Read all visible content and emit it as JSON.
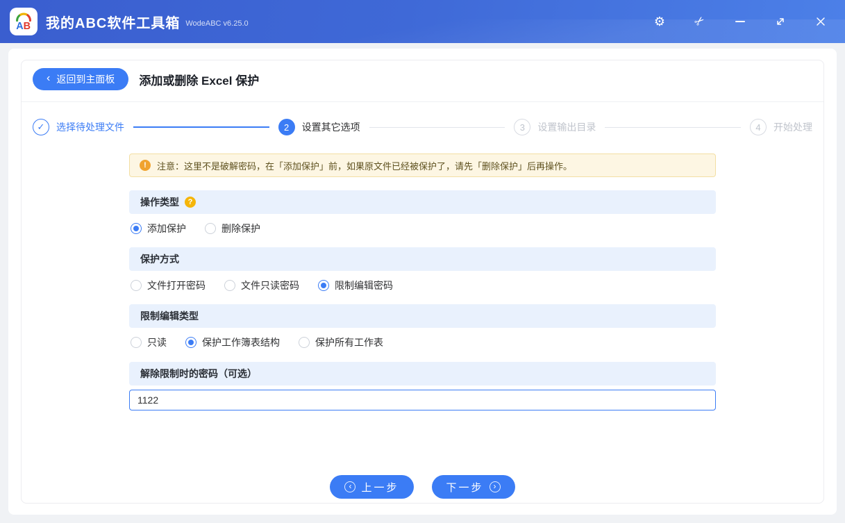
{
  "colors": {
    "accent_blue": "#3b7cf5",
    "titlebar_blue": "#3f66d4",
    "section_header_bg": "#e9f1fd",
    "warning_bg": "#fdf6e3",
    "warning_border": "#f3dfa3",
    "warning_icon": "#f0a32f",
    "help_icon": "#f5b50a",
    "step_inactive_text": "#c0c4cc"
  },
  "icons": {
    "gear": "⚙",
    "scissors": "✂",
    "back_chevron": "‹",
    "check": "✓",
    "help": "?",
    "warning": "!",
    "prev_chevron": "‹",
    "next_chevron": "›"
  },
  "titlebar": {
    "logo_a": "A",
    "logo_b": "B",
    "app_title": "我的ABC软件工具箱",
    "version": "WodeABC v6.25.0"
  },
  "header": {
    "back_label": "返回到主面板",
    "page_title": "添加或删除 Excel 保护"
  },
  "steps": [
    {
      "marker": "✓",
      "label": "选择待处理文件",
      "state": "done"
    },
    {
      "marker": "2",
      "label": "设置其它选项",
      "state": "active"
    },
    {
      "marker": "3",
      "label": "设置输出目录",
      "state": "pending"
    },
    {
      "marker": "4",
      "label": "开始处理",
      "state": "pending"
    }
  ],
  "notice": {
    "text": "注意：这里不是破解密码，在「添加保护」前，如果原文件已经被保护了，请先「删除保护」后再操作。"
  },
  "form": {
    "groups": [
      {
        "title": "操作类型",
        "options": [
          {
            "label": "添加保护",
            "selected": true
          },
          {
            "label": "删除保护",
            "selected": false
          }
        ]
      },
      {
        "title": "保护方式",
        "options": [
          {
            "label": "文件打开密码",
            "selected": false
          },
          {
            "label": "文件只读密码",
            "selected": false
          },
          {
            "label": "限制编辑密码",
            "selected": true
          }
        ]
      },
      {
        "title": "限制编辑类型",
        "options": [
          {
            "label": "只读",
            "selected": false
          },
          {
            "label": "保护工作簿表结构",
            "selected": true
          },
          {
            "label": "保护所有工作表",
            "selected": false
          }
        ]
      },
      {
        "title": "解除限制时的密码（可选）",
        "input_value": "1122"
      }
    ]
  },
  "footer": {
    "prev_label": "上一步",
    "next_label": "下一步"
  }
}
